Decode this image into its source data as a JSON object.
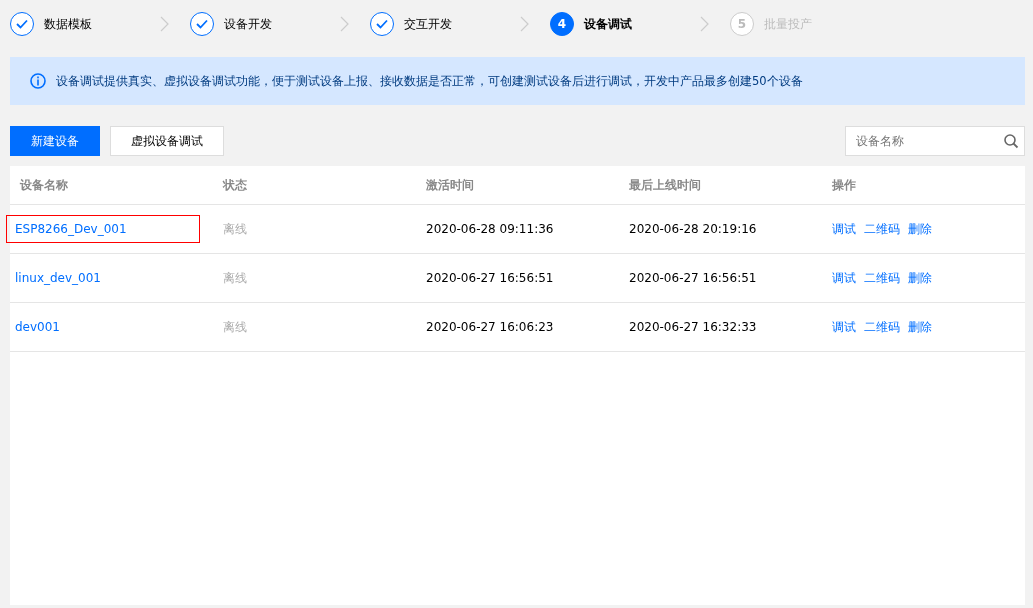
{
  "steps": [
    {
      "label": "数据模板",
      "done": true,
      "selected": false
    },
    {
      "label": "设备开发",
      "done": true,
      "selected": false
    },
    {
      "label": "交互开发",
      "done": true,
      "selected": false
    },
    {
      "number": "4",
      "label": "设备调试",
      "done": false,
      "selected": true
    },
    {
      "number": "5",
      "label": "批量投产",
      "done": false,
      "selected": false
    }
  ],
  "notice": "设备调试提供真实、虚拟设备调试功能，便于测试设备上报、接收数据是否正常，可创建测试设备后进行调试，开发中产品最多创建50个设备",
  "toolbar": {
    "buttons": [
      {
        "label": "新建设备",
        "primary": true
      },
      {
        "label": "虚拟设备调试",
        "primary": false
      }
    ],
    "search": {
      "placeholder": "设备名称"
    }
  },
  "table": {
    "columns": [
      "设备名称",
      "状态",
      "激活时间",
      "最后上线时间",
      "操作"
    ],
    "rows": [
      {
        "name": "ESP8266_Dev_001",
        "highlighted": true,
        "status": "离线",
        "activated": "2020-06-28 09:11:36",
        "last_online": "2020-06-28 20:19:16",
        "actions": [
          "调试",
          "二维码",
          "删除"
        ]
      },
      {
        "name": "linux_dev_001",
        "highlighted": false,
        "status": "离线",
        "activated": "2020-06-27 16:56:51",
        "last_online": "2020-06-27 16:56:51",
        "actions": [
          "调试",
          "二维码",
          "删除"
        ]
      },
      {
        "name": "dev001",
        "highlighted": false,
        "status": "离线",
        "activated": "2020-06-27 16:06:23",
        "last_online": "2020-06-27 16:32:33",
        "actions": [
          "调试",
          "二维码",
          "删除"
        ]
      }
    ]
  }
}
